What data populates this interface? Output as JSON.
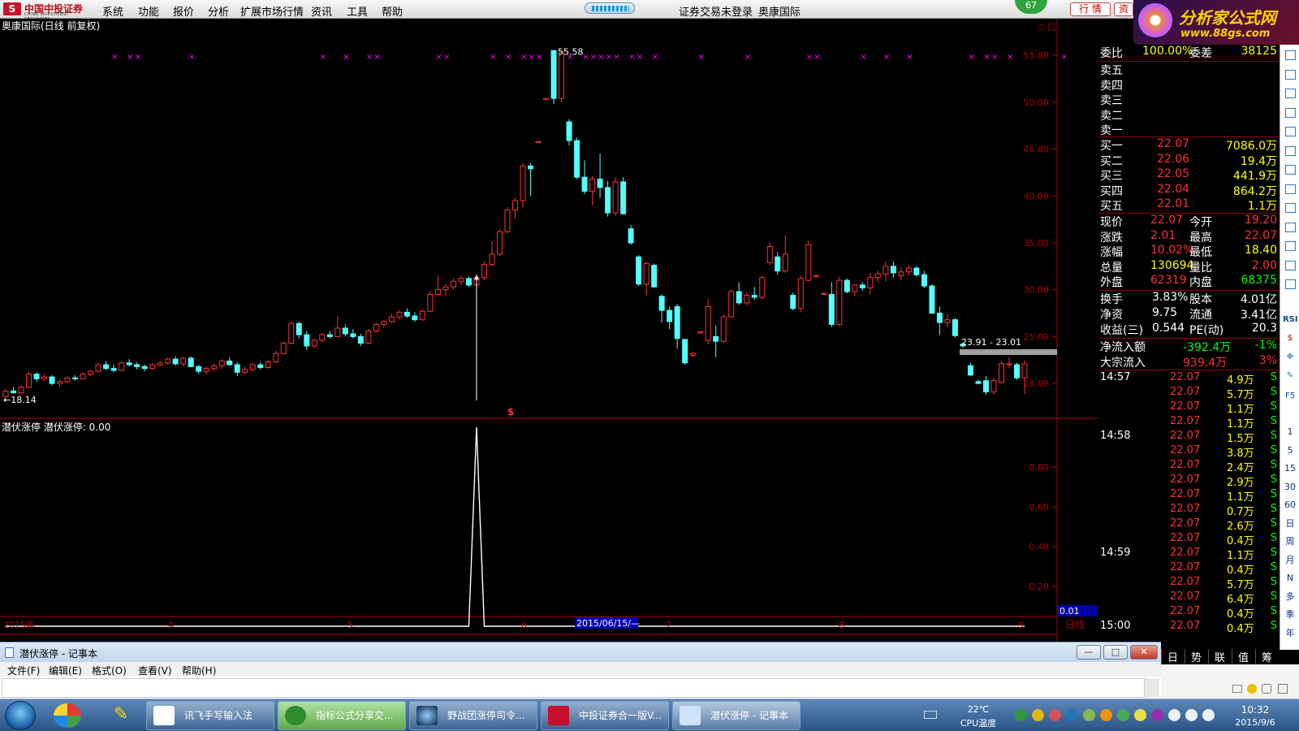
{
  "menubar": {
    "brand_cn": "中国中投证券",
    "brand_en": "CHINA INVESTMENT SECURITIES",
    "items": [
      "系统",
      "功能",
      "报价",
      "分析",
      "扩展市场行情",
      "资讯",
      "工具",
      "帮助"
    ],
    "status_trade": "证券交易未登录",
    "status_stock": "奥康国际",
    "badge": "67",
    "btn_quote": "行 情",
    "btn_info": "资"
  },
  "brand_banner": {
    "line1": "分析家公式网",
    "line2": "www.88gs.com",
    "sub": "奥康国际"
  },
  "main_chart": {
    "title": "奥康国际(日线 前复权)",
    "y_ticks": [
      "55.00",
      "50.00",
      "45.00",
      "40.00",
      "35.00",
      "30.00",
      "25.00",
      "20.00"
    ],
    "high_label": "55.58",
    "low_label": "←18.14",
    "range_label": "23.91 - 23.01",
    "signal_marker": "$"
  },
  "indicator": {
    "title": "潜伏涨停  潜伏涨停: 0.00",
    "y_ticks": [
      "0.80",
      "0.60",
      "0.40",
      "0.20"
    ],
    "current_value": "0.01"
  },
  "date_axis": {
    "labels": [
      "2015年",
      "4",
      "5",
      "6",
      "2015/06/15/—",
      "7",
      "8",
      "9"
    ],
    "period": "日线"
  },
  "chart_data": [
    {
      "type": "candlestick",
      "title": "奥康国际(日线 前复权)",
      "y_range": [
        17.5,
        57
      ],
      "y_ticks": [
        55,
        50,
        45,
        40,
        35,
        30,
        25,
        20
      ],
      "x_month_labels": [
        "2015年",
        "4",
        "5",
        "6",
        "7",
        "8",
        "9"
      ],
      "max": 55.58,
      "min": 18.14,
      "ohlc": [
        [
          18.6,
          19.4,
          18.1,
          19.2
        ],
        [
          19.2,
          19.6,
          18.9,
          19.0
        ],
        [
          19.0,
          19.8,
          18.9,
          19.6
        ],
        [
          19.6,
          21.3,
          19.5,
          21.0
        ],
        [
          21.0,
          21.2,
          20.2,
          20.5
        ],
        [
          20.5,
          21.0,
          20.3,
          20.7
        ],
        [
          20.7,
          20.9,
          19.8,
          20.0
        ],
        [
          20.0,
          20.4,
          19.6,
          20.2
        ],
        [
          20.2,
          20.8,
          20.1,
          20.6
        ],
        [
          20.6,
          20.9,
          20.3,
          20.5
        ],
        [
          20.5,
          21.2,
          20.4,
          21.0
        ],
        [
          21.0,
          21.4,
          20.8,
          21.3
        ],
        [
          21.3,
          22.2,
          21.2,
          22.0
        ],
        [
          22.0,
          22.4,
          21.4,
          21.6
        ],
        [
          21.6,
          22.0,
          21.2,
          21.4
        ],
        [
          21.4,
          22.4,
          21.3,
          22.2
        ],
        [
          22.2,
          22.6,
          21.8,
          22.0
        ],
        [
          22.0,
          22.3,
          21.5,
          21.8
        ],
        [
          21.8,
          22.0,
          21.3,
          21.6
        ],
        [
          21.6,
          22.2,
          21.5,
          22.0
        ],
        [
          22.0,
          22.4,
          21.8,
          22.2
        ],
        [
          22.2,
          22.8,
          22.0,
          22.6
        ],
        [
          22.6,
          22.9,
          21.9,
          22.1
        ],
        [
          22.1,
          22.8,
          21.8,
          22.7
        ],
        [
          22.7,
          22.9,
          21.7,
          21.8
        ],
        [
          21.8,
          22.0,
          21.0,
          21.3
        ],
        [
          21.3,
          21.8,
          21.0,
          21.6
        ],
        [
          21.6,
          22.1,
          21.3,
          21.9
        ],
        [
          21.9,
          22.6,
          21.6,
          22.4
        ],
        [
          22.4,
          22.8,
          21.9,
          22.0
        ],
        [
          22.0,
          22.3,
          20.8,
          21.2
        ],
        [
          21.2,
          21.8,
          21.0,
          21.5
        ],
        [
          21.5,
          22.2,
          21.3,
          22.0
        ],
        [
          22.0,
          22.3,
          21.5,
          21.7
        ],
        [
          21.7,
          22.5,
          21.6,
          22.3
        ],
        [
          22.3,
          23.5,
          22.2,
          23.2
        ],
        [
          23.2,
          24.5,
          23.1,
          24.3
        ],
        [
          24.3,
          26.6,
          24.2,
          26.4
        ],
        [
          26.4,
          26.6,
          24.8,
          25.2
        ],
        [
          25.2,
          25.6,
          23.6,
          24.0
        ],
        [
          24.0,
          24.8,
          23.8,
          24.6
        ],
        [
          24.6,
          25.4,
          24.4,
          25.2
        ],
        [
          25.2,
          25.6,
          24.8,
          25.0
        ],
        [
          25.0,
          27.2,
          24.9,
          25.9
        ],
        [
          25.9,
          26.3,
          25.0,
          25.3
        ],
        [
          25.3,
          25.8,
          24.8,
          25.0
        ],
        [
          25.0,
          25.3,
          24.0,
          24.3
        ],
        [
          24.3,
          25.8,
          24.2,
          25.6
        ],
        [
          25.6,
          26.5,
          25.4,
          26.3
        ],
        [
          26.3,
          26.8,
          25.9,
          26.6
        ],
        [
          26.6,
          27.4,
          26.4,
          27.1
        ],
        [
          27.1,
          27.8,
          26.8,
          27.6
        ],
        [
          27.6,
          28.0,
          27.0,
          27.2
        ],
        [
          27.2,
          27.6,
          26.6,
          26.8
        ],
        [
          26.8,
          27.9,
          26.7,
          27.7
        ],
        [
          27.7,
          29.8,
          27.6,
          29.5
        ],
        [
          29.5,
          31.5,
          29.4,
          30.0
        ],
        [
          30.0,
          30.6,
          29.4,
          30.3
        ],
        [
          30.3,
          31.2,
          30.0,
          30.9
        ],
        [
          30.9,
          31.5,
          30.5,
          31.2
        ],
        [
          31.2,
          31.4,
          30.3,
          30.5
        ],
        [
          30.5,
          31.5,
          30.3,
          31.3
        ],
        [
          31.3,
          33.0,
          31.0,
          32.7
        ],
        [
          32.7,
          35.2,
          32.5,
          33.8
        ],
        [
          33.8,
          36.5,
          33.6,
          36.2
        ],
        [
          36.2,
          38.8,
          36.0,
          38.5
        ],
        [
          38.5,
          39.8,
          37.6,
          39.5
        ],
        [
          39.5,
          43.5,
          38.8,
          43.2
        ],
        [
          43.2,
          43.5,
          40.0,
          42.9
        ],
        [
          45.8,
          45.8,
          45.8,
          45.8
        ],
        [
          50.4,
          50.4,
          50.4,
          50.4
        ],
        [
          55.5,
          55.58,
          49.8,
          50.4
        ],
        [
          50.4,
          53.8,
          50.0,
          55.3
        ],
        [
          47.9,
          48.2,
          45.4,
          45.9
        ],
        [
          45.9,
          46.2,
          41.8,
          42.0
        ],
        [
          42.0,
          43.8,
          40.2,
          40.5
        ],
        [
          40.5,
          42.1,
          39.0,
          41.8
        ],
        [
          41.8,
          44.5,
          39.8,
          40.9
        ],
        [
          40.9,
          41.6,
          37.8,
          38.2
        ],
        [
          38.2,
          42.0,
          37.9,
          41.5
        ],
        [
          41.5,
          42.0,
          38.0,
          38.1
        ],
        [
          36.5,
          36.9,
          34.8,
          35.0
        ],
        [
          33.5,
          33.7,
          30.4,
          30.6
        ],
        [
          30.6,
          33.0,
          29.4,
          32.8
        ],
        [
          32.6,
          32.8,
          30.2,
          30.3
        ],
        [
          29.3,
          29.5,
          26.5,
          27.8
        ],
        [
          27.8,
          28.2,
          25.8,
          26.6
        ],
        [
          28.2,
          28.5,
          23.7,
          24.8
        ],
        [
          24.7,
          24.7,
          22.0,
          22.2
        ],
        [
          23.0,
          23.4,
          22.8,
          23.2
        ],
        [
          25.5,
          25.6,
          25.4,
          25.5
        ],
        [
          24.6,
          29.0,
          24.2,
          28.2
        ],
        [
          25.0,
          26.2,
          22.8,
          24.5
        ],
        [
          24.5,
          27.4,
          24.3,
          27.1
        ],
        [
          27.1,
          30.0,
          27.0,
          29.8
        ],
        [
          29.8,
          30.8,
          28.4,
          28.6
        ],
        [
          28.6,
          29.7,
          28.3,
          29.4
        ],
        [
          29.4,
          30.3,
          28.9,
          29.2
        ],
        [
          29.2,
          31.5,
          29.0,
          31.3
        ],
        [
          32.9,
          35.0,
          32.6,
          34.6
        ],
        [
          33.5,
          34.0,
          31.6,
          32.0
        ],
        [
          32.0,
          35.8,
          31.8,
          33.8
        ],
        [
          29.4,
          29.7,
          27.8,
          28.0
        ],
        [
          28.0,
          31.5,
          27.6,
          31.2
        ],
        [
          31.0,
          35.2,
          30.9,
          34.8
        ],
        [
          31.5,
          31.6,
          31.4,
          31.5
        ],
        [
          29.6,
          29.8,
          29.4,
          29.6
        ],
        [
          29.5,
          30.8,
          26.0,
          26.3
        ],
        [
          26.3,
          31.4,
          26.1,
          31.0
        ],
        [
          31.0,
          31.2,
          29.6,
          29.8
        ],
        [
          29.8,
          30.6,
          29.3,
          30.5
        ],
        [
          30.5,
          30.8,
          29.9,
          30.2
        ],
        [
          30.2,
          31.8,
          29.5,
          31.3
        ],
        [
          31.3,
          32.0,
          30.8,
          31.7
        ],
        [
          31.7,
          33.0,
          30.9,
          32.5
        ],
        [
          32.5,
          33.0,
          31.3,
          31.8
        ],
        [
          31.5,
          32.4,
          31.0,
          31.9
        ],
        [
          31.9,
          32.6,
          31.5,
          32.3
        ],
        [
          32.3,
          32.5,
          31.4,
          31.6
        ],
        [
          31.6,
          32.0,
          30.2,
          30.4
        ],
        [
          30.4,
          30.6,
          27.4,
          27.5
        ],
        [
          27.5,
          28.2,
          25.2,
          26.5
        ],
        [
          26.5,
          27.4,
          26.0,
          26.8
        ],
        [
          26.8,
          27.0,
          24.9,
          25.1
        ],
        [
          24.2,
          24.4,
          23.8,
          24.0
        ],
        [
          21.9,
          22.2,
          20.8,
          20.9
        ],
        [
          20.2,
          20.4,
          19.9,
          20.0
        ],
        [
          20.3,
          20.8,
          18.8,
          19.1
        ],
        [
          19.1,
          20.6,
          18.8,
          20.3
        ],
        [
          20.1,
          22.4,
          20.0,
          22.1
        ],
        [
          22.0,
          22.8,
          21.6,
          22.1
        ],
        [
          22.0,
          22.2,
          20.4,
          20.6
        ],
        [
          20.6,
          22.5,
          18.9,
          22.1
        ]
      ]
    },
    {
      "type": "line",
      "title": "潜伏涨停",
      "series": [
        {
          "name": "潜伏涨停",
          "peak_index": 61,
          "peak_value": 1.0,
          "baseline": 0
        }
      ],
      "y_ticks": [
        0.8,
        0.6,
        0.4,
        0.2
      ],
      "current": 0.01
    }
  ],
  "quote_panel": {
    "weibi": {
      "label": "委比",
      "value": "100.00%",
      "label2": "委差",
      "value2": "38125"
    },
    "sell": [
      {
        "label": "卖五"
      },
      {
        "label": "卖四"
      },
      {
        "label": "卖三"
      },
      {
        "label": "卖二"
      },
      {
        "label": "卖一"
      }
    ],
    "buy": [
      {
        "label": "买一",
        "price": "22.07",
        "vol": "7086.0万"
      },
      {
        "label": "买二",
        "price": "22.06",
        "vol": "19.4万"
      },
      {
        "label": "买三",
        "price": "22.05",
        "vol": "441.9万"
      },
      {
        "label": "买四",
        "price": "22.04",
        "vol": "864.2万"
      },
      {
        "label": "买五",
        "price": "22.01",
        "vol": "1.1万"
      }
    ],
    "stats": [
      {
        "l1": "现价",
        "v1": "22.07",
        "l2": "今开",
        "v2": "19.20",
        "c1": "#ff3030",
        "c2": "#ff3030"
      },
      {
        "l1": "涨跌",
        "v1": "2.01",
        "l2": "最高",
        "v2": "22.07",
        "c1": "#ff3030",
        "c2": "#ff3030"
      },
      {
        "l1": "涨幅",
        "v1": "10.02%",
        "l2": "最低",
        "v2": "18.40",
        "c1": "#ff3030",
        "c2": "#ffff00"
      },
      {
        "l1": "总量",
        "v1": "130694",
        "l2": "量比",
        "v2": "2.00",
        "c1": "#ffff00",
        "c2": "#ff3030"
      },
      {
        "l1": "外盘",
        "v1": "62319",
        "l2": "内盘",
        "v2": "68375",
        "c1": "#ff3030",
        "c2": "#00ff00"
      }
    ],
    "fin": [
      {
        "l1": "换手",
        "v1": "3.83%",
        "l2": "股本",
        "v2": "4.01亿"
      },
      {
        "l1": "净资",
        "v1": "9.75",
        "l2": "流通",
        "v2": "3.41亿"
      },
      {
        "l1": "收益(三)",
        "v1": "0.544",
        "l2": "PE(动)",
        "v2": "20.3"
      }
    ],
    "flows": [
      {
        "label": "净流入额",
        "value": "-392.4万",
        "pct": "-1%",
        "color": "#00ff00"
      },
      {
        "label": "大宗流入",
        "value": "939.4万",
        "pct": "3%",
        "color": "#ff3030"
      }
    ],
    "ticks": [
      {
        "t": "14:57",
        "p": "22.07",
        "v": "4.9万",
        "s": "S"
      },
      {
        "t": "",
        "p": "22.07",
        "v": "5.7万",
        "s": "S"
      },
      {
        "t": "",
        "p": "22.07",
        "v": "1.1万",
        "s": "S"
      },
      {
        "t": "",
        "p": "22.07",
        "v": "1.1万",
        "s": "S"
      },
      {
        "t": "14:58",
        "p": "22.07",
        "v": "1.5万",
        "s": "S"
      },
      {
        "t": "",
        "p": "22.07",
        "v": "3.8万",
        "s": "S"
      },
      {
        "t": "",
        "p": "22.07",
        "v": "2.4万",
        "s": "S"
      },
      {
        "t": "",
        "p": "22.07",
        "v": "2.9万",
        "s": "S"
      },
      {
        "t": "",
        "p": "22.07",
        "v": "1.1万",
        "s": "S"
      },
      {
        "t": "",
        "p": "22.07",
        "v": "0.7万",
        "s": "S"
      },
      {
        "t": "",
        "p": "22.07",
        "v": "2.6万",
        "s": "S"
      },
      {
        "t": "",
        "p": "22.07",
        "v": "0.4万",
        "s": "S"
      },
      {
        "t": "14:59",
        "p": "22.07",
        "v": "1.1万",
        "s": "S"
      },
      {
        "t": "",
        "p": "22.07",
        "v": "0.4万",
        "s": "S"
      },
      {
        "t": "",
        "p": "22.07",
        "v": "5.7万",
        "s": "S"
      },
      {
        "t": "",
        "p": "22.07",
        "v": "6.4万",
        "s": "S"
      },
      {
        "t": "",
        "p": "22.07",
        "v": "0.4万",
        "s": "S"
      },
      {
        "t": "15:00",
        "p": "22.07",
        "v": "0.4万",
        "s": "S"
      }
    ],
    "tabs": [
      "日",
      "势",
      "联",
      "值",
      "筹"
    ]
  },
  "right_toolbar": {
    "periods": [
      "1",
      "5",
      "15",
      "30",
      "60",
      "日",
      "周",
      "月",
      "N",
      "多",
      "季",
      "年"
    ],
    "tools": [
      "RSI",
      "F10",
      "F5"
    ]
  },
  "notepad": {
    "title": "潜伏涨停 - 记事本",
    "menu": [
      "文件(F)",
      "编辑(E)",
      "格式(O)",
      "查看(V)",
      "帮助(H)"
    ],
    "btn_min": "—",
    "btn_max": "□",
    "btn_close": "✕"
  },
  "taskbar": {
    "items": [
      "讯飞手写输入法",
      "指标公式分享交...",
      "野战团涨停司令...",
      "中投证券合一版V...",
      "潜伏涨停 - 记事本"
    ],
    "temp": "22℃",
    "temp_label": "CPU温度",
    "time": "10:32",
    "date": "2015/9/6"
  },
  "colors": {
    "up": "#ff3030",
    "down": "#54ffff",
    "frame": "#b00000",
    "marker": "#ff00ff"
  }
}
